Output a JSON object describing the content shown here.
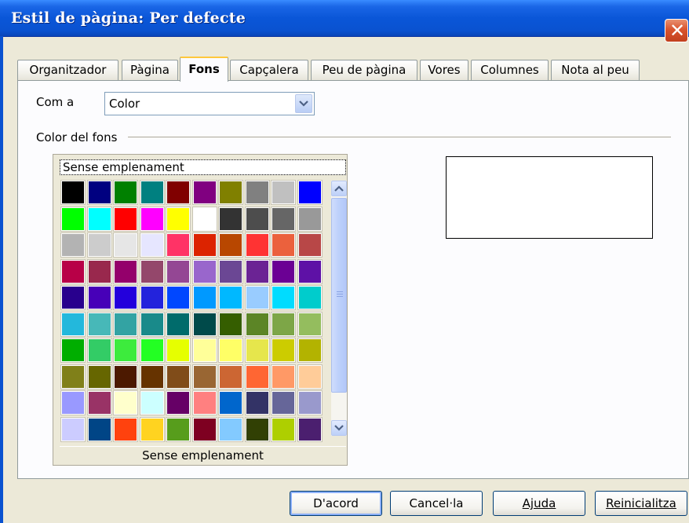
{
  "window": {
    "title": "Estil de pàgina: Per defecte",
    "close_glyph": "✕"
  },
  "tabs": [
    {
      "label": "Organitzador",
      "active": false
    },
    {
      "label": "Pàgina",
      "active": false
    },
    {
      "label": "Fons",
      "active": true
    },
    {
      "label": "Capçalera",
      "active": false
    },
    {
      "label": "Peu de pàgina",
      "active": false
    },
    {
      "label": "Vores",
      "active": false
    },
    {
      "label": "Columnes",
      "active": false
    },
    {
      "label": "Nota al peu",
      "active": false
    }
  ],
  "background": {
    "as_label": "Com a",
    "as_value": "Color",
    "color_section_label": "Color del fons",
    "no_fill_top": "Sense emplenament",
    "no_fill_bottom": "Sense emplenament",
    "palette": [
      [
        "#000000",
        "#000080",
        "#008000",
        "#008080",
        "#800000",
        "#800080",
        "#808000",
        "#808080",
        "#c0c0c0",
        "#0000ff"
      ],
      [
        "#00ff00",
        "#00ffff",
        "#ff0000",
        "#ff00ff",
        "#ffff00",
        "#ffffff",
        "#333333",
        "#4d4d4d",
        "#666666",
        "#999999"
      ],
      [
        "#b3b3b3",
        "#cccccc",
        "#e6e6e6",
        "#e6e6ff",
        "#ff3366",
        "#dc2300",
        "#b84700",
        "#ff3333",
        "#eb613d",
        "#b84747"
      ],
      [
        "#b80047",
        "#99284d",
        "#94006b",
        "#94476b",
        "#944794",
        "#9966cc",
        "#6b4794",
        "#6b2394",
        "#6b0094",
        "#5e11a6"
      ],
      [
        "#28008d",
        "#4700b8",
        "#2300dc",
        "#2323dc",
        "#0047ff",
        "#0099ff",
        "#00b8ff",
        "#99ccff",
        "#00dcff",
        "#00cccc"
      ],
      [
        "#23b8dc",
        "#47b8b8",
        "#33a3a3",
        "#198a8a",
        "#006b6b",
        "#004a4a",
        "#355e00",
        "#5c8526",
        "#7da647",
        "#94bd5e"
      ],
      [
        "#00ae00",
        "#33cc66",
        "#3deb3d",
        "#23ff23",
        "#e6ff00",
        "#ffff99",
        "#ffff66",
        "#e6e64c",
        "#cccc00",
        "#b3b300"
      ],
      [
        "#808019",
        "#666600",
        "#4c1900",
        "#663300",
        "#804c19",
        "#996633",
        "#cc6633",
        "#ff6633",
        "#ff9966",
        "#ffcc99"
      ],
      [
        "#9999ff",
        "#993366",
        "#ffffcc",
        "#ccffff",
        "#660066",
        "#ff8080",
        "#0066cc",
        "#333366",
        "#666699",
        "#9999cc"
      ],
      [
        "#ccccff",
        "#004586",
        "#ff420e",
        "#ffd320",
        "#579d1c",
        "#7e0021",
        "#83caff",
        "#314004",
        "#aecf00",
        "#4b1f6f"
      ]
    ]
  },
  "buttons": {
    "ok": "D'acord",
    "cancel": "Cancel·la",
    "help": "Ajuda",
    "reset": "Reinicialitza"
  },
  "icons": {
    "close": "close-icon",
    "dropdown": "chevron-down-icon",
    "scroll_up": "chevron-up-icon",
    "scroll_down": "chevron-down-icon"
  }
}
